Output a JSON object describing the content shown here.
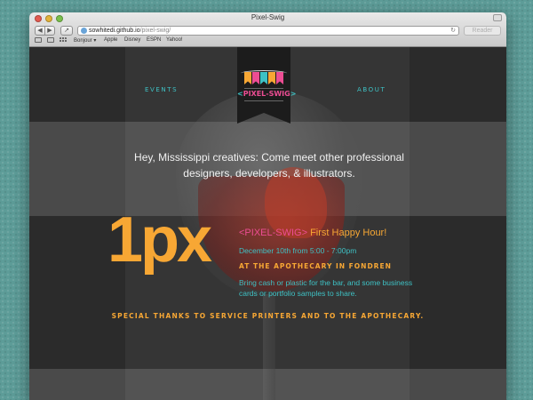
{
  "browser": {
    "window_title": "Pixel-Swig",
    "url_host": "sowhitedi.github.io",
    "url_path": "/pixel-swig/",
    "reader_label": "Reader",
    "bookmarks": [
      "Bonjour ▾",
      "Apple",
      "Disney",
      "ESPN",
      "Yahoo!"
    ]
  },
  "nav": {
    "events_label": "EVENTS",
    "about_label": "ABOUT"
  },
  "logo": {
    "open_bracket": "<",
    "name": "PIXEL-SWIG",
    "close_bracket": ">",
    "pennant_colors": [
      "#f7a734",
      "#ec4d93",
      "#3ec1c4",
      "#f7a734",
      "#ec4d93"
    ]
  },
  "hero": {
    "tagline_line1": "Hey, Mississippi creatives: Come meet other professional",
    "tagline_line2": "designers, developers, & illustrators."
  },
  "event": {
    "big_label": "1px",
    "title_bracketed": "<PIXEL-SWIG>",
    "title_rest": " First Happy Hour!",
    "date": "December 10th from 5:00 - 7:00pm",
    "venue": "AT THE APOTHECARY IN FONDREN",
    "note": "Bring cash or plastic for the bar, and some business cards or portfolio samples to share."
  },
  "footer": {
    "thanks": "SPECIAL THANKS TO SERVICE PRINTERS AND TO THE APOTHECARY."
  },
  "colors": {
    "orange": "#f7a734",
    "pink": "#ec4d93",
    "teal": "#3ec1c4",
    "background_teal": "#5d9c98"
  }
}
